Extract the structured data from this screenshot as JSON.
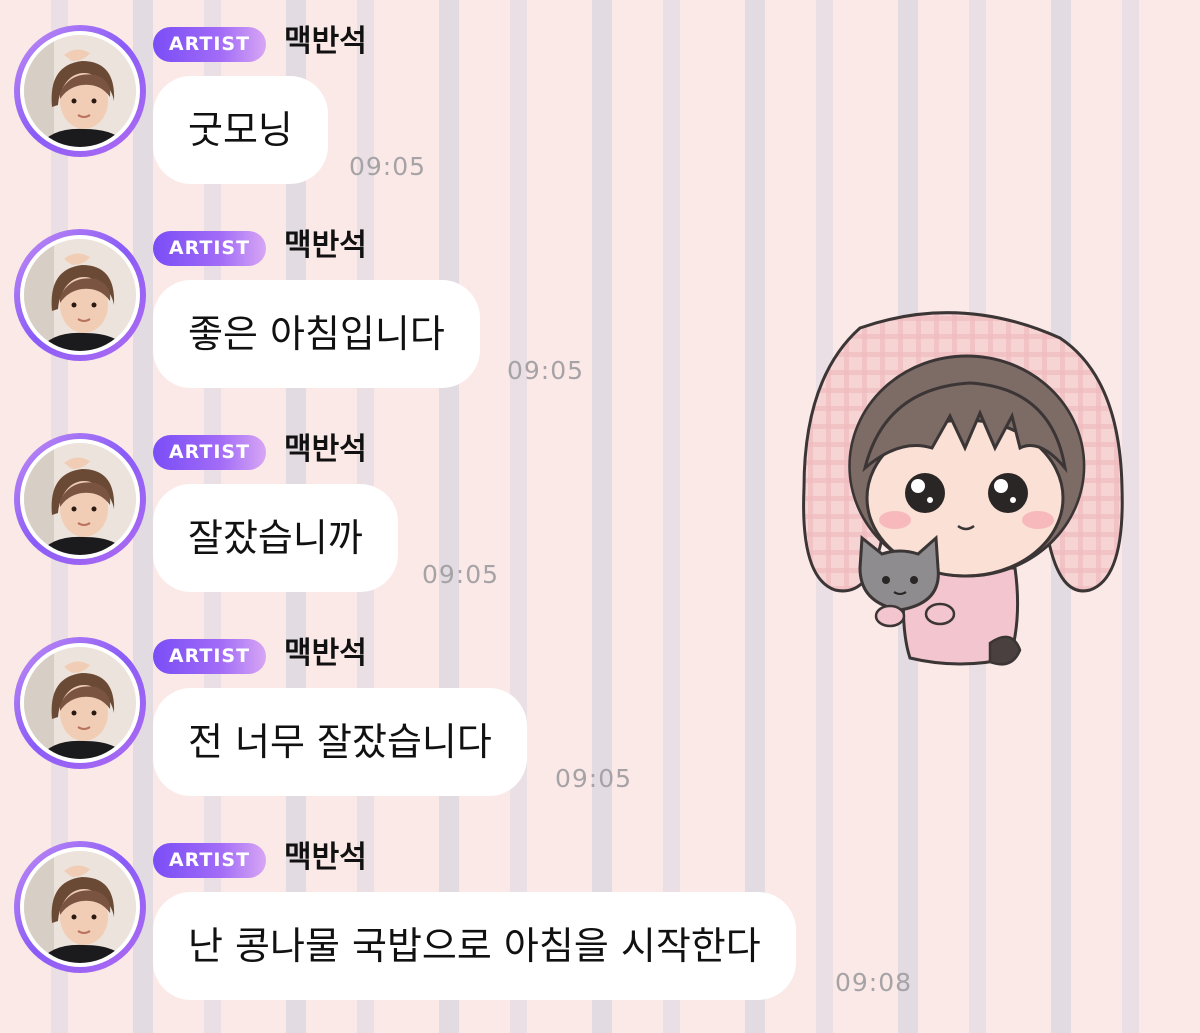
{
  "colors": {
    "badge_gradient_start": "#7a4df6",
    "badge_gradient_end": "#d7a6f4",
    "avatar_ring": "#8a5cf7",
    "bubble_bg": "#ffffff",
    "timestamp": "#a6a3a6",
    "stripe_pink": "#fbe9e8",
    "stripe_lavender": "#e3dbe2"
  },
  "messages": [
    {
      "badge": "ARTIST",
      "sender": "맥반석",
      "text": "굿모닝",
      "time": "09:05"
    },
    {
      "badge": "ARTIST",
      "sender": "맥반석",
      "text": "좋은 아침입니다",
      "time": "09:05"
    },
    {
      "badge": "ARTIST",
      "sender": "맥반석",
      "text": "잘잤습니까",
      "time": "09:05"
    },
    {
      "badge": "ARTIST",
      "sender": "맥반석",
      "text": "전 너무 잘잤습니다",
      "time": "09:05"
    },
    {
      "badge": "ARTIST",
      "sender": "맥반석",
      "text": "난 콩나물 국밥으로 아침을 시작한다",
      "time": "09:08"
    }
  ],
  "sticker": {
    "icon": "chibi-bunny-hood-with-cat-sticker"
  }
}
